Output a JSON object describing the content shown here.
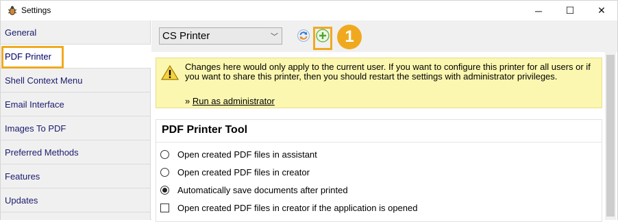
{
  "window": {
    "title": "Settings",
    "app_icon": "bug-icon",
    "controls": {
      "minimize": "─",
      "maximize": "☐",
      "close": "✕"
    }
  },
  "sidebar": {
    "items": [
      {
        "label": "General",
        "active": false
      },
      {
        "label": "PDF Printer",
        "active": true
      },
      {
        "label": "Shell Context Menu",
        "active": false
      },
      {
        "label": "Email Interface",
        "active": false
      },
      {
        "label": "Images To PDF",
        "active": false
      },
      {
        "label": "Preferred Methods",
        "active": false
      },
      {
        "label": "Features",
        "active": false
      },
      {
        "label": "Updates",
        "active": false
      }
    ]
  },
  "toolbar": {
    "printer_select": {
      "value": "CS Printer",
      "chevron": "﹀"
    },
    "refresh_icon": "refresh-icon",
    "add_icon": "add-icon",
    "callout_number": "1"
  },
  "notice": {
    "icon": "warning-icon",
    "text": "Changes here would only apply to the current user. If you want to configure this printer for all users or if you want to share this printer, then you should restart the settings with administrator privileges.",
    "link_prefix": "» ",
    "link_label": "Run as administrator"
  },
  "pdf_printer_tool": {
    "title": "PDF Printer Tool",
    "options": [
      {
        "type": "radio",
        "checked": false,
        "label": "Open created PDF files in assistant"
      },
      {
        "type": "radio",
        "checked": false,
        "label": "Open created PDF files in creator"
      },
      {
        "type": "radio",
        "checked": true,
        "label": "Automatically save documents after printed"
      },
      {
        "type": "checkbox",
        "checked": false,
        "label": "Open created PDF files in creator if the application is opened"
      }
    ]
  },
  "colors": {
    "highlight": "#f0a91f",
    "notice_bg": "#fbf7b0",
    "nav_text": "#1a1a6e"
  }
}
